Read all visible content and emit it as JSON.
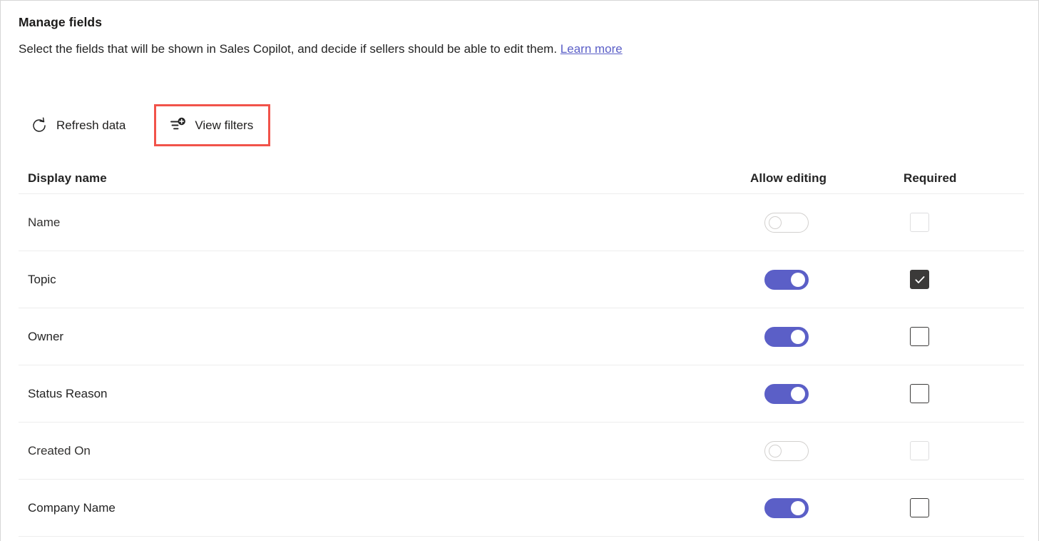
{
  "header": {
    "title": "Manage fields",
    "subtitle_text": "Select the fields that will be shown in Sales Copilot, and decide if sellers should be able to edit them.",
    "learn_more_label": "Learn more"
  },
  "toolbar": {
    "refresh_label": "Refresh data",
    "refresh_icon": "refresh-icon",
    "view_filters_label": "View filters",
    "view_filters_icon": "filter-add-icon",
    "highlight_color": "#f1534a"
  },
  "table": {
    "columns": {
      "display_name": "Display name",
      "allow_editing": "Allow editing",
      "required": "Required"
    },
    "rows": [
      {
        "display_name": "Name",
        "allow_editing": "off",
        "allow_editing_disabled": true,
        "required": "unchecked",
        "required_disabled": true
      },
      {
        "display_name": "Topic",
        "allow_editing": "on",
        "allow_editing_disabled": false,
        "required": "checked",
        "required_disabled": false
      },
      {
        "display_name": "Owner",
        "allow_editing": "on",
        "allow_editing_disabled": false,
        "required": "unchecked",
        "required_disabled": false
      },
      {
        "display_name": "Status Reason",
        "allow_editing": "on",
        "allow_editing_disabled": false,
        "required": "unchecked",
        "required_disabled": false
      },
      {
        "display_name": "Created On",
        "allow_editing": "off",
        "allow_editing_disabled": true,
        "required": "unchecked",
        "required_disabled": true
      },
      {
        "display_name": "Company Name",
        "allow_editing": "on",
        "allow_editing_disabled": false,
        "required": "unchecked",
        "required_disabled": false
      }
    ]
  },
  "colors": {
    "toggle_on": "#5b5fc7",
    "checkbox_checked": "#3b3a39",
    "link": "#5b5fc7",
    "text": "#242424",
    "divider": "#ededed"
  }
}
